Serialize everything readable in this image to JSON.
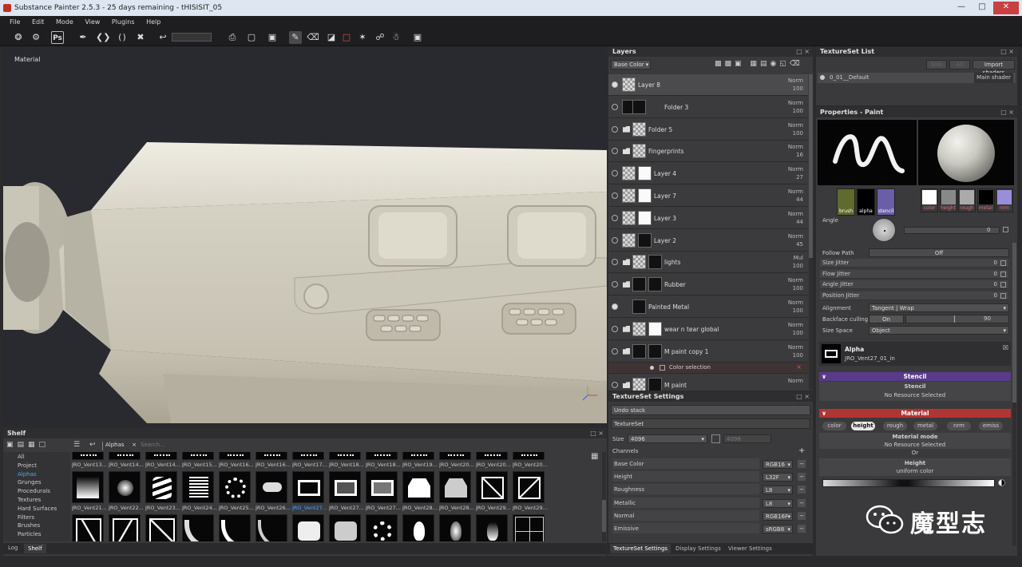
{
  "title_bar": {
    "title": "Substance Painter 2.5.3 - 25 days remaining - tHISISIT_05"
  },
  "menu": [
    "File",
    "Edit",
    "Mode",
    "View",
    "Plugins",
    "Help"
  ],
  "toolbar": {
    "ps_label": "Ps"
  },
  "viewport": {
    "label": "Material"
  },
  "layers_panel": {
    "title": "Layers",
    "channel_dropdown": "Base Color",
    "layers": [
      {
        "name": "Layer 8",
        "blend": "Norm",
        "opacity": "100"
      },
      {
        "name": "Folder 3",
        "blend": "Norm",
        "opacity": "100"
      },
      {
        "name": "Folder 5",
        "blend": "Norm",
        "opacity": "100"
      },
      {
        "name": "Fingerprints",
        "blend": "Norm",
        "opacity": "16"
      },
      {
        "name": "Layer 4",
        "blend": "Norm",
        "opacity": "27"
      },
      {
        "name": "Layer 7",
        "blend": "Norm",
        "opacity": "44"
      },
      {
        "name": "Layer 3",
        "blend": "Norm",
        "opacity": "44"
      },
      {
        "name": "Layer 2",
        "blend": "Norm",
        "opacity": "45"
      },
      {
        "name": "lights",
        "blend": "Mul",
        "opacity": "100"
      },
      {
        "name": "Rubber",
        "blend": "Norm",
        "opacity": "100"
      },
      {
        "name": "Painted Metal",
        "blend": "Norm",
        "opacity": "100"
      },
      {
        "name": "wear n tear global",
        "blend": "Norm",
        "opacity": "100"
      },
      {
        "name": "M paint copy 1",
        "blend": "Norm",
        "opacity": "100"
      }
    ],
    "color_selection": "Color selection",
    "last_layer": {
      "name": "M paint",
      "blend": "Norm"
    }
  },
  "textureset_settings": {
    "title": "TextureSet Settings",
    "undo_stack": "Undo stack",
    "textureset": "TextureSet",
    "size_label": "Size",
    "size_value": "4096",
    "size_value2": "4096",
    "channels_label": "Channels",
    "channels": [
      {
        "name": "Base Color",
        "format": "RGB16"
      },
      {
        "name": "Height",
        "format": "L32F"
      },
      {
        "name": "Roughness",
        "format": "L8"
      },
      {
        "name": "Metallic",
        "format": "L8"
      },
      {
        "name": "Normal",
        "format": "RGB16F"
      },
      {
        "name": "Emissive",
        "format": "sRGB8"
      }
    ],
    "bottom_tabs": [
      "TextureSet Settings",
      "Display Settings",
      "Viewer Settings"
    ]
  },
  "textureset_list": {
    "title": "TextureSet List",
    "btn_solo": "Solo",
    "btn_all": "All",
    "import_shaders": "Import shaders",
    "item_name": "0_01__Default",
    "item_shader": "Main shader"
  },
  "properties": {
    "title": "Properties - Paint",
    "brush_slots": [
      "brush",
      "alpha",
      "stencil"
    ],
    "material_slots": [
      "color",
      "height",
      "rough",
      "metal",
      "nrm"
    ],
    "angle_label": "Angle",
    "angle_value": "0",
    "follow_path_label": "Follow Path",
    "follow_path_value": "Off",
    "jitters": [
      {
        "label": "Size Jitter",
        "value": "0"
      },
      {
        "label": "Flow Jitter",
        "value": "0"
      },
      {
        "label": "Angle Jitter",
        "value": "0"
      },
      {
        "label": "Position Jitter",
        "value": "0"
      }
    ],
    "alignment_label": "Alignment",
    "alignment_value": "Tangent | Wrap",
    "backface_label": "Backface culling",
    "backface_on": "On",
    "backface_value": "90",
    "size_space_label": "Size Space",
    "size_space_value": "Object",
    "alpha_title": "Alpha",
    "alpha_resource": "JRO_Vent27_01_in",
    "stencil_header": "Stencil",
    "stencil_sub": "Stencil",
    "stencil_none": "No Resource Selected",
    "material_header": "Material",
    "material_tabs": [
      "color",
      "height",
      "rough",
      "metal",
      "nrm",
      "emiss"
    ],
    "material_mode_label": "Material mode",
    "material_mode_value": "No Resource Selected",
    "or_label": "Or",
    "height_label": "Height",
    "uniform_color": "uniform color"
  },
  "shelf": {
    "title": "Shelf",
    "filter": "Alphas",
    "search_placeholder": "Search...",
    "categories": [
      "All",
      "Project",
      "Alphas",
      "Grunges",
      "Procedurals",
      "Textures",
      "Hard Surfaces",
      "Filters",
      "Brushes",
      "Particles"
    ],
    "active_category": "Alphas",
    "row1_labels": [
      "JRO_Vent13...",
      "JRO_Vent14...",
      "JRO_Vent14...",
      "JRO_Vent15...",
      "JRO_Vent16...",
      "JRO_Vent16...",
      "JRO_Vent17...",
      "JRO_Vent18...",
      "JRO_Vent18...",
      "JRO_Vent19...",
      "JRO_Vent20...",
      "JRO_Vent20...",
      "JRO_Vent20..."
    ],
    "row2_labels": [
      "JRO_Vent21...",
      "JRO_Vent22...",
      "JRO_Vent23...",
      "JRO_Vent24...",
      "JRO_Vent25...",
      "JRO_Vent26...",
      "JRO_Vent27...",
      "JRO_Vent27...",
      "JRO_Vent27...",
      "JRO_Vent28...",
      "JRO_Vent28...",
      "JRO_Vent29...",
      "JRO_Vent29..."
    ],
    "bottom_tabs": [
      "Log",
      "Shelf"
    ]
  },
  "watermark": {
    "text": "魔型志"
  }
}
